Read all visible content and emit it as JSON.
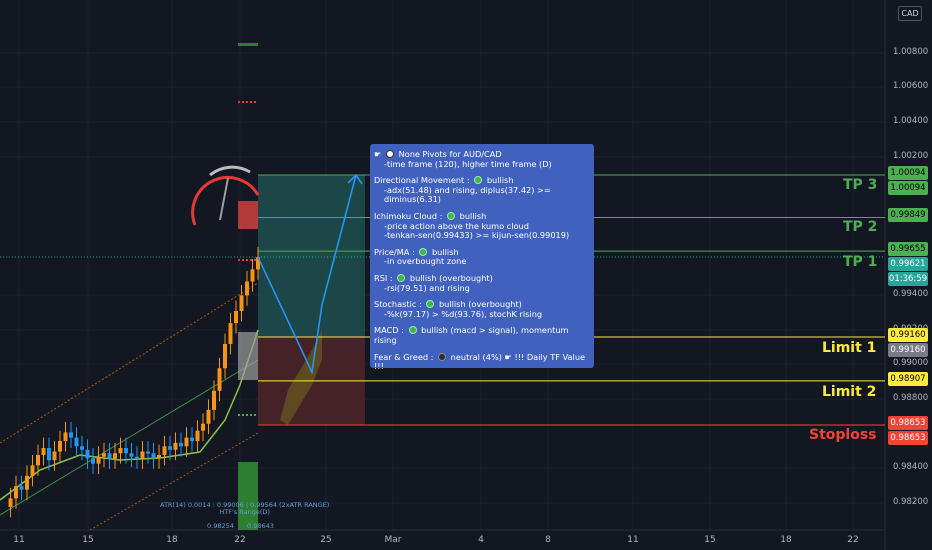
{
  "currency_label": "CAD",
  "price_axis": [
    "1.00800",
    "1.00600",
    "1.00400",
    "1.00200",
    "0.99400",
    "0.99200",
    "0.99000",
    "0.98800",
    "0.98400",
    "0.98200"
  ],
  "x_axis": [
    "11",
    "15",
    "18",
    "22",
    "25",
    "Mar",
    "4",
    "8",
    "11",
    "15",
    "18",
    "22"
  ],
  "targets": {
    "tp3": {
      "label": "TP 3",
      "price": "1.00094",
      "color": "#4caf50"
    },
    "tp2": {
      "label": "TP 2",
      "price": "0.99849",
      "color": "#4caf50"
    },
    "tp1": {
      "label": "TP 1",
      "price": "0.99655",
      "color": "#4caf50"
    },
    "limit1": {
      "label": "Limit 1",
      "price": "0.99160",
      "color": "#ffeb3b"
    },
    "limit2": {
      "label": "Limit 2",
      "price": "0.98907",
      "color": "#ffeb3b"
    },
    "stoploss": {
      "label": "Stoploss",
      "price": "0.98653",
      "color": "#f44336"
    }
  },
  "price_tags": {
    "tp3_a": "1.00094",
    "tp3_b": "1.00094",
    "tp2": "0.99849",
    "tp1": "0.99655",
    "current": "0.99621",
    "countdown": "01:36:59",
    "limit1_a": "0.99160",
    "limit1_b": "0.99160",
    "limit2": "0.98907",
    "stop_a": "0.98653",
    "stop_b": "0.98653"
  },
  "tooltip": {
    "header": "None Pivots for AUD/CAD",
    "header_sub": "-time frame (120), higher time frame (D)",
    "dm_title": "Directional Movement :",
    "dm_state": "bullish",
    "dm_sub": "-adx(51.48) and rising, diplus(37.42) >= diminus(6.31)",
    "ichi_title": "Ichimoku Cloud :",
    "ichi_state": "bullish",
    "ichi_sub1": "-price action above the kumo cloud",
    "ichi_sub2": "-tenkan-sen(0.99433) >= kijun-sen(0.99019)",
    "ma_title": "Price/MA :",
    "ma_state": "bullish",
    "ma_sub": "-in overbought zone",
    "rsi_title": "RSI :",
    "rsi_state": "bullish (overbought)",
    "rsi_sub": "-rsi(79.51) and rising",
    "stoch_title": "Stochastic :",
    "stoch_state": "bullish (overbought)",
    "stoch_sub": "-%k(97.17) > %d(93.76), stochK rising",
    "macd_title": "MACD :",
    "macd_state": "bullish (macd > signal), momentum rising",
    "fg_title": "Fear & Greed :",
    "fg_state": "neutral (4%)",
    "fg_extra": "!!! Daily TF Value !!!"
  },
  "atr_text": "ATR(14) 0.0014 : 0.99006 | 0.99564 (2xATR RANGE)",
  "atr_sub": "HTF's Range(D)",
  "atr_low": "0.98254",
  "atr_high": "0.98643",
  "colors": {
    "background": "#131722",
    "bull": "#f7931a",
    "bear": "#2196f3",
    "tp": "#4caf50",
    "limit": "#ffeb3b",
    "stop": "#f44336"
  },
  "chart_data": {
    "type": "candlestick",
    "symbol": "AUD/CAD",
    "y_range": [
      0.981,
      1.009
    ],
    "levels": {
      "tp3": 1.00094,
      "tp2": 0.99849,
      "tp1": 0.99655,
      "current": 0.99621,
      "limit1": 0.9916,
      "limit2": 0.98907,
      "stoploss": 0.98653
    },
    "close_path": [
      0.9818,
      0.9823,
      0.983,
      0.9828,
      0.9836,
      0.9842,
      0.9848,
      0.9852,
      0.9845,
      0.985,
      0.9856,
      0.9861,
      0.9858,
      0.9853,
      0.9851,
      0.9846,
      0.9843,
      0.9847,
      0.9849,
      0.9846,
      0.9849,
      0.9852,
      0.9849,
      0.9847,
      0.9846,
      0.985,
      0.9849,
      0.9846,
      0.9848,
      0.9853,
      0.9851,
      0.9855,
      0.9853,
      0.9858,
      0.9856,
      0.9862,
      0.9866,
      0.9874,
      0.9885,
      0.9898,
      0.9912,
      0.9924,
      0.9931,
      0.994,
      0.9948,
      0.9955,
      0.9962
    ],
    "projection": [
      0.99621,
      0.98957,
      0.99345,
      1.00094
    ]
  }
}
